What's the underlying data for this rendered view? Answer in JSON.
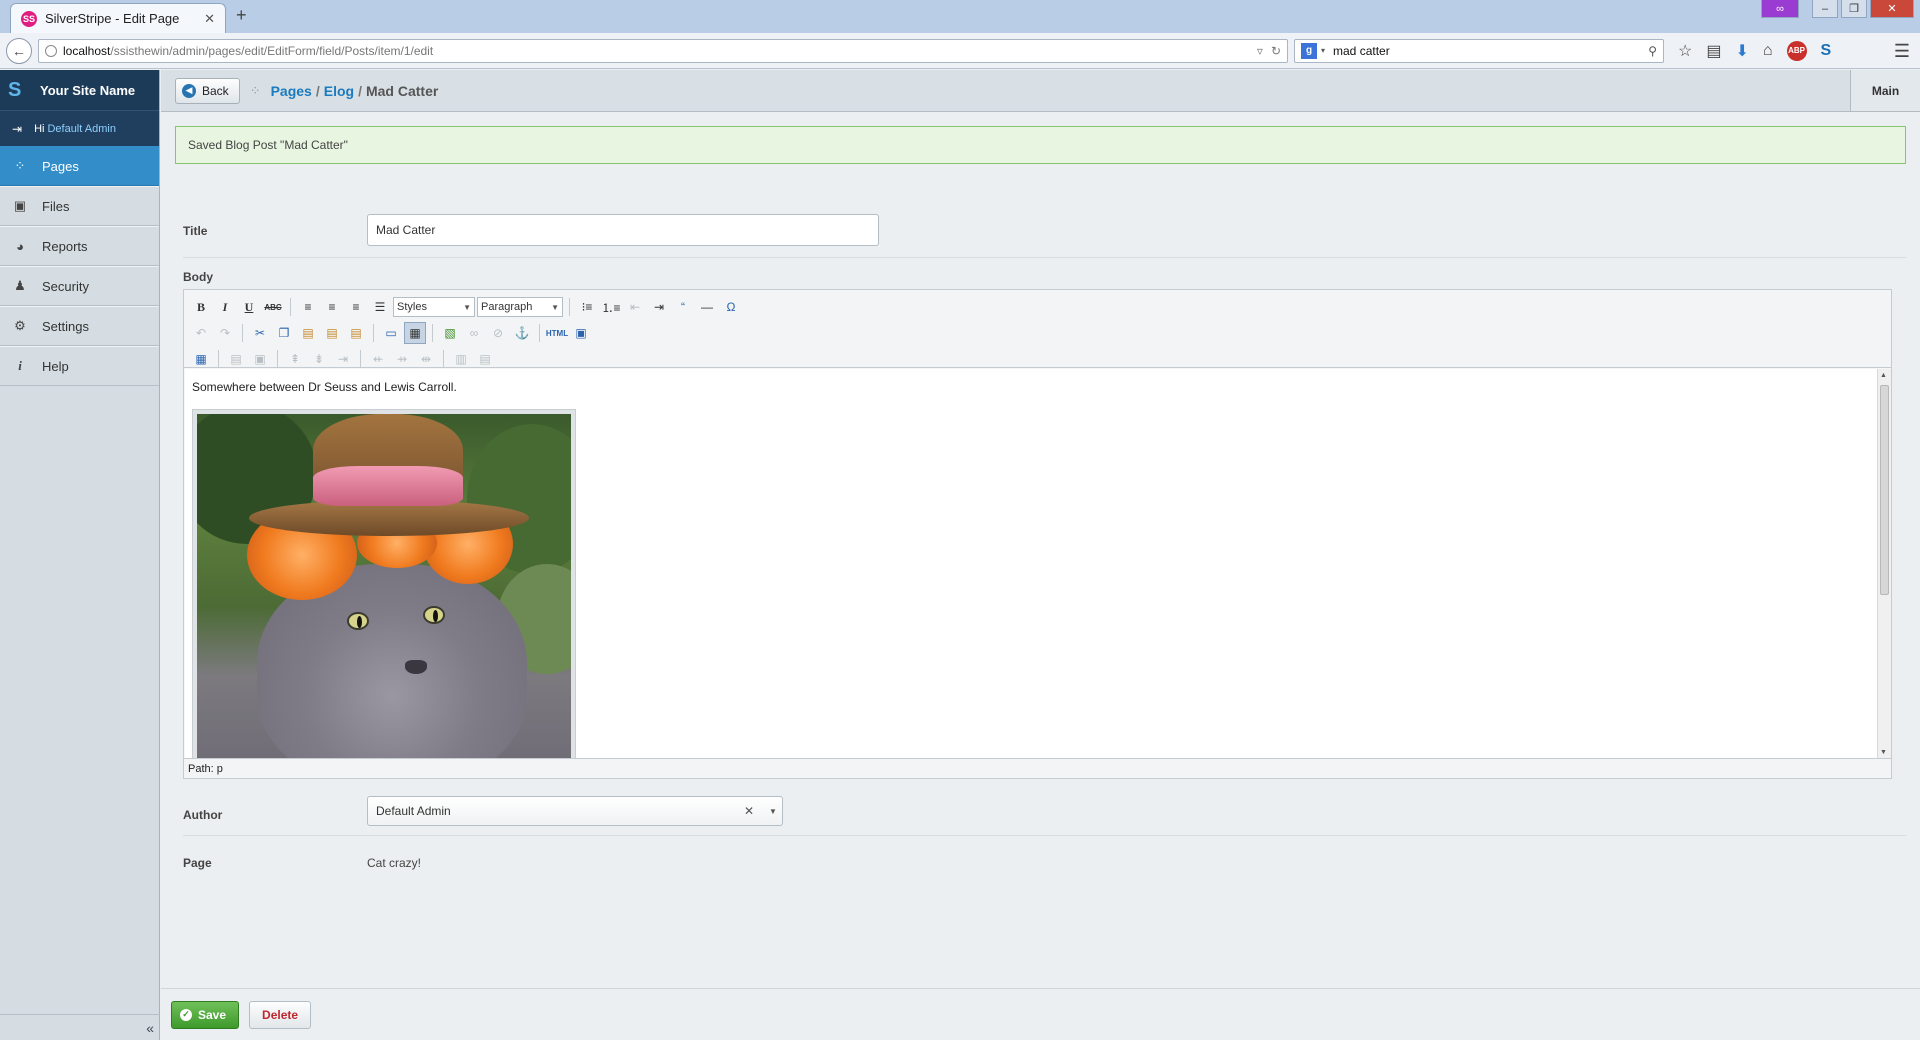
{
  "browser": {
    "tab_title": "SilverStripe - Edit Page",
    "tab_favicon_text": "SS",
    "url_host": "localhost",
    "url_path": "/ssisthewin/admin/pages/edit/EditForm/field/Posts/item/1/edit",
    "search_engine_badge": "g",
    "search_query": "mad catter",
    "abp_label": "ABP"
  },
  "sidebar": {
    "site_name": "Your Site Name",
    "greeting": "Hi",
    "user_name": "Default Admin",
    "items": [
      {
        "label": "Pages",
        "icon": "pages-icon",
        "active": true
      },
      {
        "label": "Files",
        "icon": "image-icon",
        "active": false
      },
      {
        "label": "Reports",
        "icon": "chart-icon",
        "active": false
      },
      {
        "label": "Security",
        "icon": "users-icon",
        "active": false
      },
      {
        "label": "Settings",
        "icon": "wrench-icon",
        "active": false
      },
      {
        "label": "Help",
        "icon": "info-icon",
        "active": false
      }
    ],
    "collapse_label": "«"
  },
  "header": {
    "back_label": "Back",
    "breadcrumb": [
      "Pages",
      "Elog",
      "Mad Catter"
    ],
    "tab_main": "Main"
  },
  "message": "Saved Blog Post \"Mad Catter\"",
  "form": {
    "title_label": "Title",
    "title_value": "Mad Catter",
    "body_label": "Body",
    "styles_select": "Styles",
    "format_select": "Paragraph",
    "body_text": "Somewhere between Dr Seuss and Lewis Carroll.",
    "path_label": "Path: p",
    "author_label": "Author",
    "author_value": "Default Admin",
    "page_label": "Page",
    "page_value": "Cat crazy!"
  },
  "actions": {
    "save_label": "Save",
    "delete_label": "Delete"
  },
  "colors": {
    "accent_blue": "#338dc9",
    "brand_dark": "#1c3b58",
    "save_green": "#3e9a2b",
    "delete_red": "#c0262d",
    "message_green": "#e8f5e0"
  }
}
